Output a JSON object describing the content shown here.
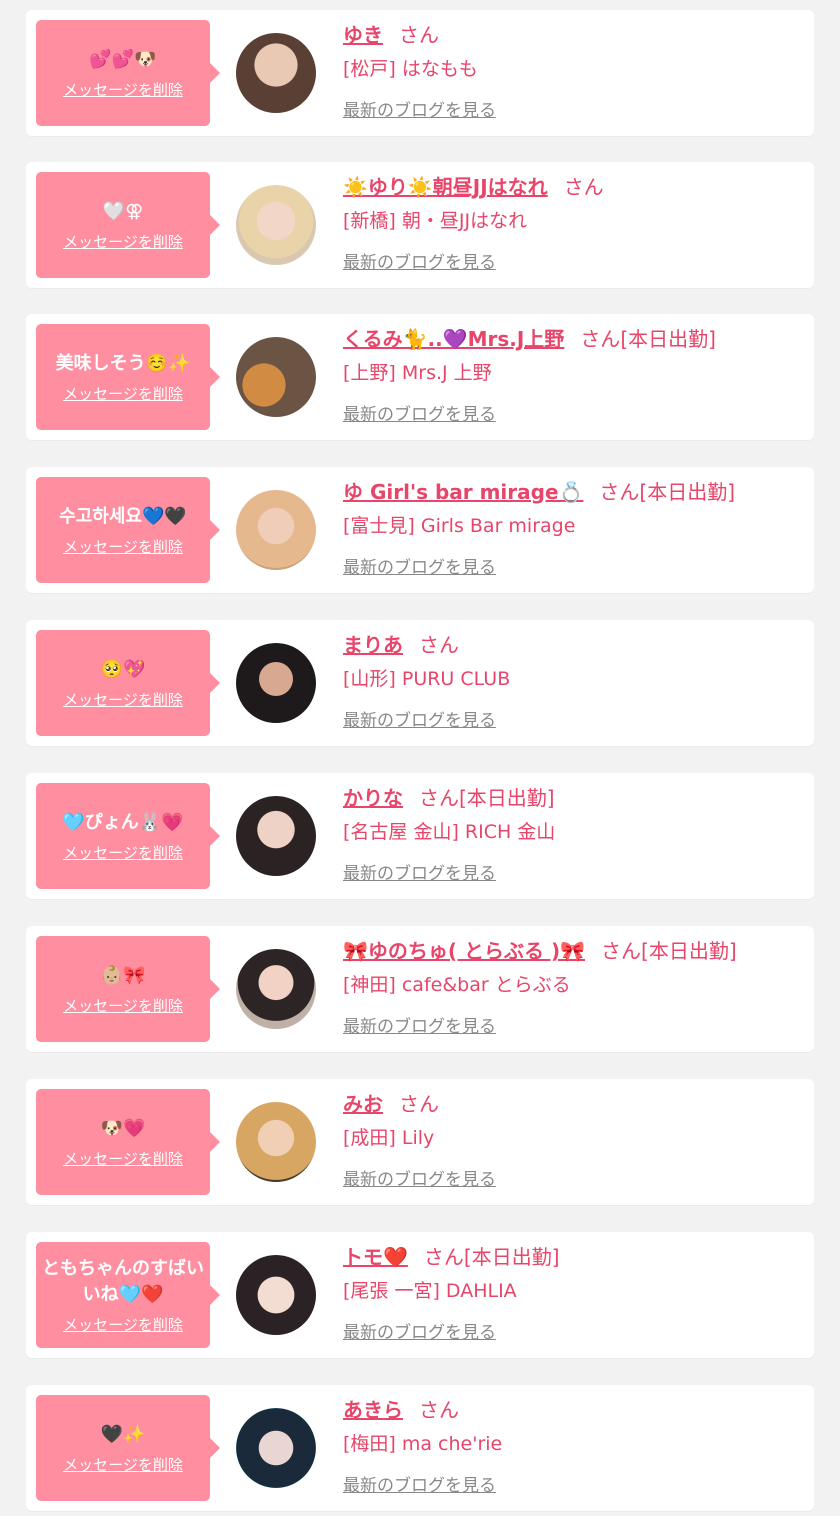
{
  "colors": {
    "accent": "#e8456a",
    "bubble": "#ff8fa0",
    "card": "#ffffff",
    "background": "#f2f2f2",
    "link_gray": "#888888"
  },
  "labels": {
    "delete": "メッセージを削除",
    "blog": "最新のブログを見る",
    "honorific": "さん"
  },
  "messages": [
    {
      "message": "💕💕🐶",
      "name": "ゆき",
      "today": "",
      "shop": "[松戸] はなもも",
      "avatar_icon": "profile-photo-icon"
    },
    {
      "message": "🤍⚢",
      "name": "☀️ゆり☀️朝昼JJはなれ",
      "today": "",
      "shop": "[新橋] 朝・昼JJはなれ",
      "avatar_icon": "profile-photo-icon"
    },
    {
      "message": "美味しそう☺️✨",
      "name": "くるみ🐈..💜Mrs.J上野",
      "today": "[本日出勤]",
      "shop": "[上野] Mrs.J 上野",
      "avatar_icon": "profile-photo-icon"
    },
    {
      "message": "수고하세요💙🖤",
      "name": "ゆ Girl's bar mirage💍",
      "today": "[本日出勤]",
      "shop": "[富士見] Girls Bar mirage",
      "avatar_icon": "profile-photo-icon"
    },
    {
      "message": "🥺💖",
      "name": "まりあ",
      "today": "",
      "shop": "[山形] PURU CLUB",
      "avatar_icon": "profile-photo-icon"
    },
    {
      "message": "🩵ぴょん🐰💗",
      "name": "かりな",
      "today": "[本日出勤]",
      "shop": "[名古屋 金山] RICH 金山",
      "avatar_icon": "profile-photo-icon"
    },
    {
      "message": "👶🏼🎀",
      "name": "🎀ゆのちゅ( とらぶる )🎀",
      "today": "[本日出勤]",
      "shop": "[神田] cafe&bar とらぶる",
      "avatar_icon": "profile-photo-icon"
    },
    {
      "message": "🐶💗",
      "name": "みお",
      "today": "",
      "shop": "[成田] Lily",
      "avatar_icon": "profile-photo-icon"
    },
    {
      "message": "ともちゃんのすばいいね🩵❤️",
      "name": "トモ❤️",
      "today": "[本日出勤]",
      "shop": "[尾張 一宮] DAHLIA",
      "avatar_icon": "profile-photo-icon"
    },
    {
      "message": "🖤✨",
      "name": "あきら",
      "today": "",
      "shop": "[梅田] ma che'rie",
      "avatar_icon": "profile-photo-icon"
    }
  ]
}
